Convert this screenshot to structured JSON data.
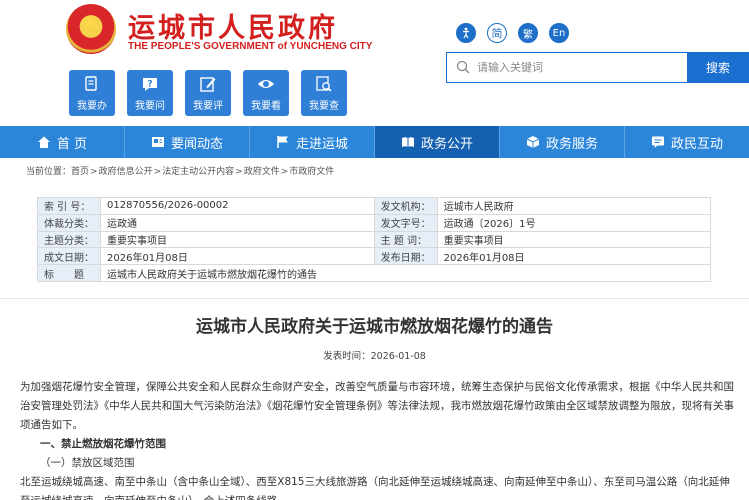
{
  "header": {
    "title": "运城市人民政府",
    "subtitle": "THE PEOPLE'S GOVERNMENT of YUNCHENG CITY"
  },
  "top_icons": [
    {
      "name": "accessibility-icon",
      "label": ""
    },
    {
      "name": "simplified-chinese-button",
      "label": "简"
    },
    {
      "name": "traditional-chinese-button",
      "label": "繁"
    },
    {
      "name": "english-button",
      "label": "En"
    }
  ],
  "search": {
    "placeholder": "请输入关键词",
    "button_label": "搜索"
  },
  "quick_links": [
    {
      "label": "我要办",
      "icon": "document-hand-icon"
    },
    {
      "label": "我要问",
      "icon": "question-bubble-icon"
    },
    {
      "label": "我要评",
      "icon": "edit-icon"
    },
    {
      "label": "我要看",
      "icon": "eye-icon"
    },
    {
      "label": "我要查",
      "icon": "search-icon"
    }
  ],
  "nav": [
    {
      "label": "首 页",
      "icon": "home-icon",
      "active": false
    },
    {
      "label": "要闻动态",
      "icon": "news-icon",
      "active": false
    },
    {
      "label": "走进运城",
      "icon": "flag-icon",
      "active": false
    },
    {
      "label": "政务公开",
      "icon": "book-icon",
      "active": true
    },
    {
      "label": "政务服务",
      "icon": "cube-icon",
      "active": false
    },
    {
      "label": "政民互动",
      "icon": "chat-icon",
      "active": false
    }
  ],
  "breadcrumb": {
    "prefix": "当前位置：",
    "items": [
      "首页",
      "政府信息公开",
      "法定主动公开内容",
      "政府文件",
      "市政府文件"
    ]
  },
  "meta": {
    "rows": [
      [
        {
          "k": "索 引 号：",
          "v": "012870556/2026-00002"
        },
        {
          "k": "发文机构：",
          "v": "运城市人民政府"
        }
      ],
      [
        {
          "k": "体裁分类：",
          "v": "运政通"
        },
        {
          "k": "发文字号：",
          "v": "运政通〔2026〕1号"
        }
      ],
      [
        {
          "k": "主题分类：",
          "v": "重要实事项目"
        },
        {
          "k": "主 题 词：",
          "v": "重要实事项目"
        }
      ],
      [
        {
          "k": "成文日期：",
          "v": "2026年01月08日"
        },
        {
          "k": "发布日期：",
          "v": "2026年01月08日"
        }
      ]
    ],
    "title_key": "标　　题",
    "title_value": "运城市人民政府关于运城市燃放烟花爆竹的通告"
  },
  "document": {
    "title": "运城市人民政府关于运城市燃放烟花爆竹的通告",
    "pub_date": "发表时间：2026-01-08",
    "para1": "为加强烟花爆竹安全管理，保障公共安全和人民群众生命财产安全，改善空气质量与市容环境，统筹生态保护与民俗文化传承需求，根据《中华人民共和国治安管理处罚法》《中华人民共和国大气污染防治法》《烟花爆竹安全管理条例》等法律法规，我市燃放烟花爆竹政策由全区域禁放调整为限放，现将有关事项通告如下。",
    "h1": "一、禁止燃放烟花爆竹范围",
    "h2": "（一）禁放区域范围",
    "para2": "北至运城绕城高速、南至中条山（含中条山全域）、西至X815三大线旅游路（向北延伸至运城绕城高速、向南延伸至中条山）、东至司马温公路（向北延伸至运城绕城高速、向南延伸至中条山）。合上述四条线路"
  }
}
